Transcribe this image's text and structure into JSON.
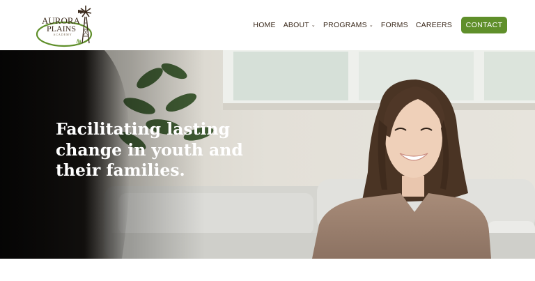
{
  "brand": {
    "line1": "AURORA",
    "line2": "PLAINS",
    "line3": "ACADEMY",
    "logo_icon": "windmill-icon",
    "colors": {
      "text": "#3b2a1c",
      "oval": "#5f8f2a"
    }
  },
  "nav": {
    "items": [
      {
        "label": "HOME",
        "has_dropdown": false
      },
      {
        "label": "ABOUT",
        "has_dropdown": true
      },
      {
        "label": "PROGRAMS",
        "has_dropdown": true
      },
      {
        "label": "FORMS",
        "has_dropdown": false
      },
      {
        "label": "CAREERS",
        "has_dropdown": false
      }
    ],
    "contact_label": "CONTACT",
    "accent_color": "#5f8f2a"
  },
  "hero": {
    "heading_line1": "Facilitating lasting",
    "heading_line2": "change in youth and",
    "heading_line3": "their families."
  }
}
